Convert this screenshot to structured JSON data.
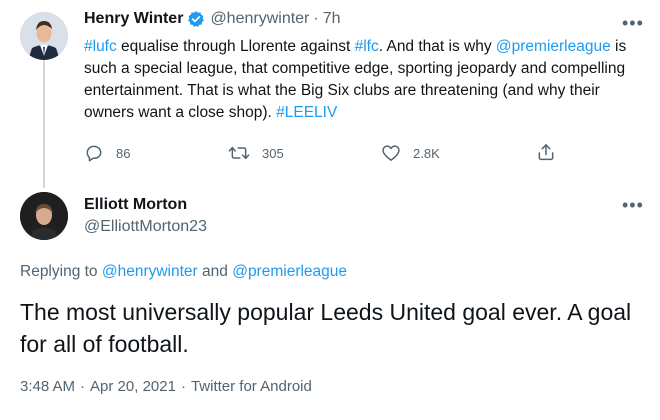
{
  "tweet": {
    "author_name": "Henry Winter",
    "verified": true,
    "handle": "@henrywinter",
    "separator": "·",
    "time": "7h",
    "text_parts": {
      "p1": "#lufc",
      "p2": " equalise through Llorente against ",
      "p3": "#lfc",
      "p4": ". And that is why ",
      "p5": "@premierleague",
      "p6": " is such a special league, that competitive edge, sporting jeopardy and compelling entertainment. That is what the Big Six clubs are threatening (and why their owners want a close shop).  ",
      "p7": "#LEELIV"
    },
    "actions": {
      "replies": "86",
      "retweets": "305",
      "likes": "2.8K"
    }
  },
  "reply": {
    "author_name": "Elliott Morton",
    "handle": "@ElliottMorton23",
    "replying_to_prefix": "Replying to ",
    "replying_to_user1": "@henrywinter",
    "replying_to_and": " and ",
    "replying_to_user2": "@premierleague",
    "text": "The most universally popular Leeds United goal ever. A goal for all of football.",
    "time": "3:48 AM",
    "date": "Apr 20, 2021",
    "separator": "·",
    "client": "Twitter for Android"
  },
  "colors": {
    "accent": "#1d9bf0",
    "text": "#0f1419",
    "secondary": "#536471"
  },
  "icons": [
    "verified-badge-icon",
    "more-options-icon",
    "reply-icon",
    "retweet-icon",
    "like-icon",
    "share-icon"
  ]
}
